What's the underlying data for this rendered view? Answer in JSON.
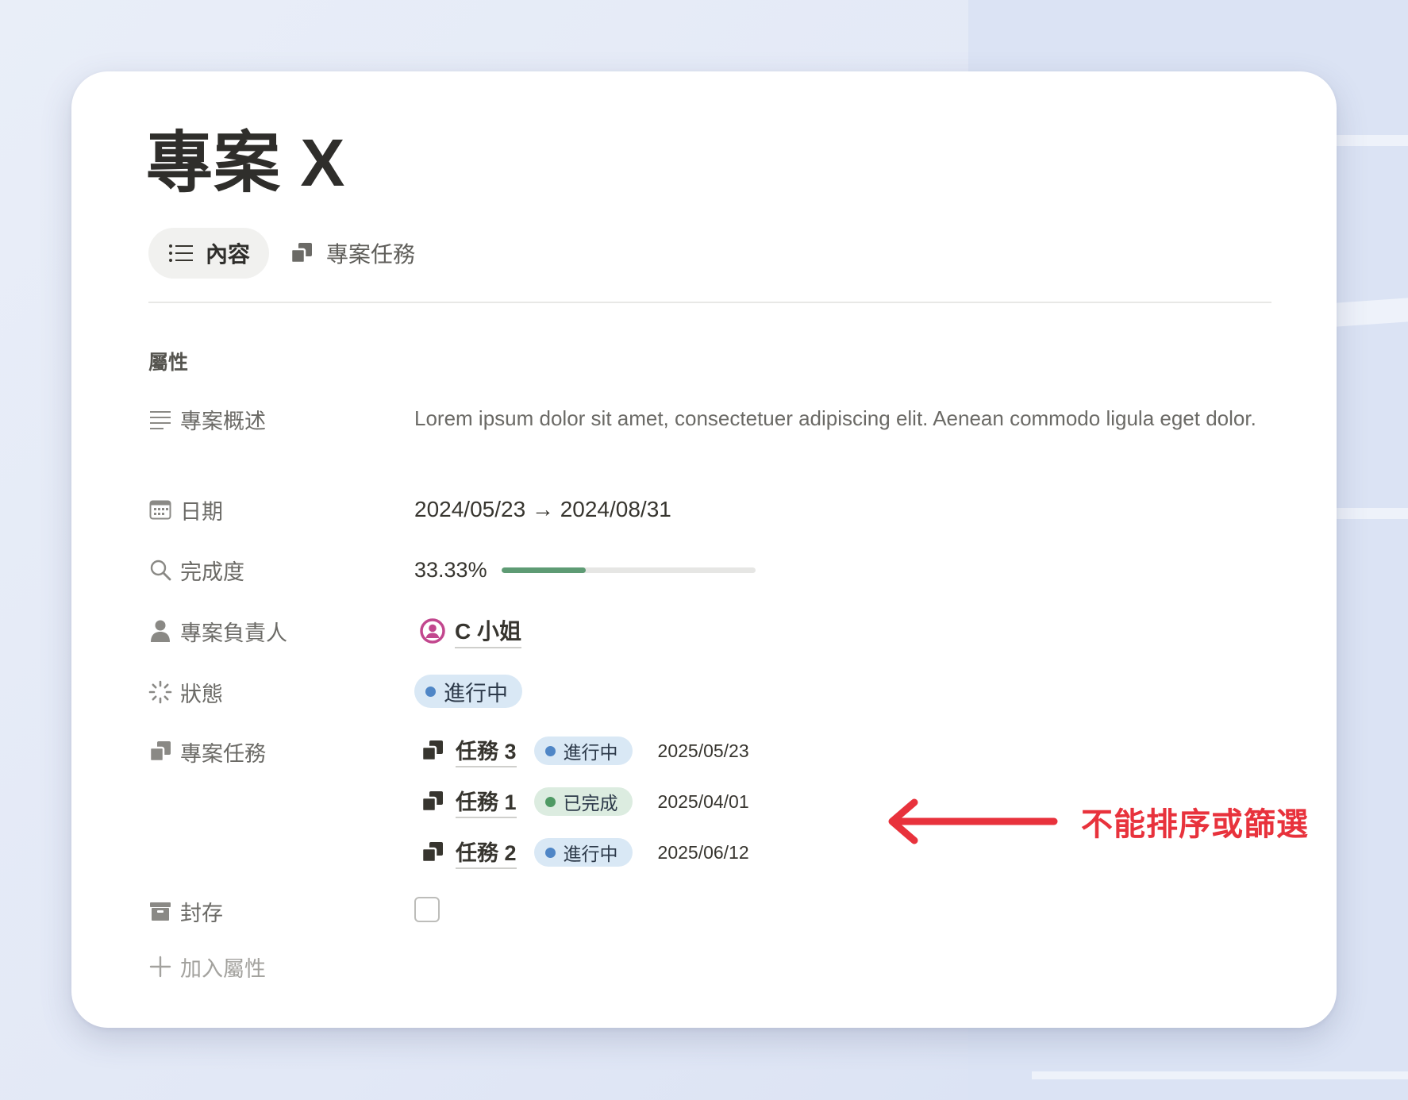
{
  "page": {
    "title": "專案 X"
  },
  "tabs": [
    {
      "label": "內容",
      "icon": "list-icon",
      "active": true
    },
    {
      "label": "專案任務",
      "icon": "stacked-pages-icon",
      "active": false
    }
  ],
  "properties": {
    "section_heading": "屬性",
    "description": {
      "label": "專案概述",
      "icon": "text-lines-icon",
      "value": "Lorem ipsum dolor sit amet, consectetuer adipiscing elit. Aenean commodo ligula eget dolor."
    },
    "date": {
      "label": "日期",
      "icon": "calendar-icon",
      "value": "2024/05/23 → 2024/08/31"
    },
    "progress": {
      "label": "完成度",
      "icon": "magnifier-icon",
      "value_text": "33.33%",
      "fraction": 0.3333,
      "color": "#5e9b74"
    },
    "owner": {
      "label": "專案負責人",
      "icon": "person-icon",
      "name": "C 小姐",
      "avatar_color": "#c2478e"
    },
    "status": {
      "label": "狀態",
      "icon": "spinner-icon",
      "value": "進行中",
      "dot_color": "#4f86c6",
      "bg_color": "#d9e8f5"
    },
    "tasks": {
      "label": "專案任務",
      "icon": "stacked-pages-icon",
      "items": [
        {
          "name": "任務 3",
          "status": "進行中",
          "status_bg": "#d9e8f5",
          "dot_color": "#4f86c6",
          "date": "2025/05/23"
        },
        {
          "name": "任務 1",
          "status": "已完成",
          "status_bg": "#dcece0",
          "dot_color": "#4f9a64",
          "date": "2025/04/01"
        },
        {
          "name": "任務 2",
          "status": "進行中",
          "status_bg": "#d9e8f5",
          "dot_color": "#4f86c6",
          "date": "2025/06/12"
        }
      ]
    },
    "archive": {
      "label": "封存",
      "icon": "archive-box-icon",
      "checked": false
    },
    "add_property": {
      "label": "加入屬性",
      "icon": "plus-icon"
    }
  },
  "annotation": {
    "text": "不能排序或篩選",
    "color": "#e8323c",
    "icon": "arrow-left-icon"
  }
}
